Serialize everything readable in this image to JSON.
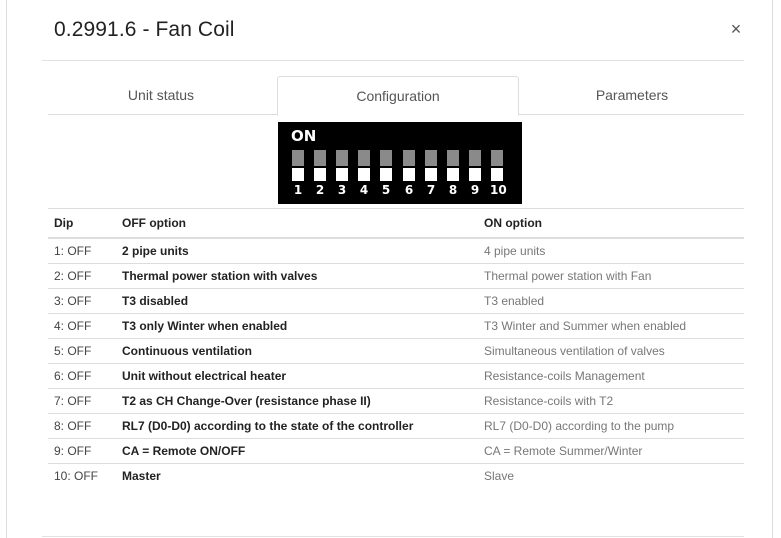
{
  "modal": {
    "title": "0.2991.6 - Fan Coil",
    "close_label": "×"
  },
  "tabs": [
    {
      "label": "Unit status",
      "active": false
    },
    {
      "label": "Configuration",
      "active": true
    },
    {
      "label": "Parameters",
      "active": false
    }
  ],
  "dip_switch": {
    "on_label": "ON",
    "switches": [
      "1",
      "2",
      "3",
      "4",
      "5",
      "6",
      "7",
      "8",
      "9",
      "10"
    ],
    "states": [
      "off",
      "off",
      "off",
      "off",
      "off",
      "off",
      "off",
      "off",
      "off",
      "off"
    ]
  },
  "table": {
    "headers": {
      "dip": "Dip",
      "off": "OFF option",
      "on": "ON option"
    },
    "rows": [
      {
        "dip": "1: OFF",
        "off": "2 pipe units",
        "on": "4 pipe units"
      },
      {
        "dip": "2: OFF",
        "off": "Thermal power station with valves",
        "on": "Thermal power station with Fan"
      },
      {
        "dip": "3: OFF",
        "off": "T3 disabled",
        "on": "T3 enabled"
      },
      {
        "dip": "4: OFF",
        "off": "T3 only Winter when enabled",
        "on": "T3 Winter and Summer when enabled"
      },
      {
        "dip": "5: OFF",
        "off": "Continuous ventilation",
        "on": "Simultaneous ventilation of valves"
      },
      {
        "dip": "6: OFF",
        "off": "Unit without electrical heater",
        "on": "Resistance-coils Management"
      },
      {
        "dip": "7: OFF",
        "off": "T2 as CH Change-Over (resistance phase II)",
        "on": "Resistance-coils with T2"
      },
      {
        "dip": "8: OFF",
        "off": "RL7 (D0-D0) according to the state of the controller",
        "on": "RL7 (D0-D0) according to the pump"
      },
      {
        "dip": "9: OFF",
        "off": "CA = Remote ON/OFF",
        "on": "CA = Remote Summer/Winter"
      },
      {
        "dip": "10: OFF",
        "off": "Master",
        "on": "Slave"
      }
    ]
  }
}
